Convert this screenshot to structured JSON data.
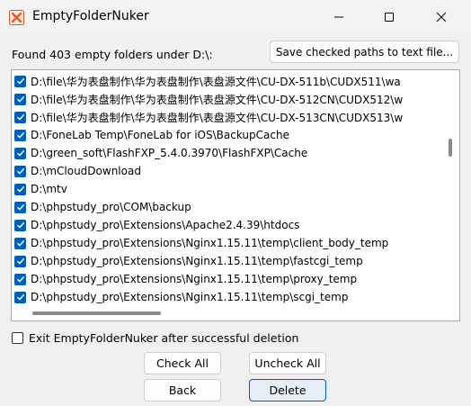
{
  "window": {
    "title": "EmptyFolderNuker",
    "app_icon": "x-icon",
    "controls": [
      "minimize-icon",
      "maximize-icon",
      "close-icon"
    ]
  },
  "header": {
    "found_text": "Found 403 empty folders under D:\\:",
    "save_button": "Save checked paths to text file..."
  },
  "folders": [
    {
      "path": "D:\\file\\华为表盘制作\\华为表盘制作\\表盘源文件\\CU-DX-511b\\CUDX511\\wa",
      "checked": true
    },
    {
      "path": "D:\\file\\华为表盘制作\\华为表盘制作\\表盘源文件\\CU-DX-512CN\\CUDX512\\w",
      "checked": true
    },
    {
      "path": "D:\\file\\华为表盘制作\\华为表盘制作\\表盘源文件\\CU-DX-513CN\\CUDX513\\w",
      "checked": true
    },
    {
      "path": "D:\\FoneLab Temp\\FoneLab for iOS\\BackupCache",
      "checked": true
    },
    {
      "path": "D:\\green_soft\\FlashFXP_5.4.0.3970\\FlashFXP\\Cache",
      "checked": true
    },
    {
      "path": "D:\\mCloudDownload",
      "checked": true
    },
    {
      "path": "D:\\mtv",
      "checked": true
    },
    {
      "path": "D:\\phpstudy_pro\\COM\\backup",
      "checked": true
    },
    {
      "path": "D:\\phpstudy_pro\\Extensions\\Apache2.4.39\\htdocs",
      "checked": true
    },
    {
      "path": "D:\\phpstudy_pro\\Extensions\\Nginx1.15.11\\temp\\client_body_temp",
      "checked": true
    },
    {
      "path": "D:\\phpstudy_pro\\Extensions\\Nginx1.15.11\\temp\\fastcgi_temp",
      "checked": true
    },
    {
      "path": "D:\\phpstudy_pro\\Extensions\\Nginx1.15.11\\temp\\proxy_temp",
      "checked": true
    },
    {
      "path": "D:\\phpstudy_pro\\Extensions\\Nginx1.15.11\\temp\\scgi_temp",
      "checked": true
    }
  ],
  "options": {
    "exit_label": "Exit EmptyFolderNuker after successful deletion",
    "exit_checked": false
  },
  "buttons": {
    "check_all": "Check All",
    "uncheck_all": "Uncheck All",
    "back": "Back",
    "delete": "Delete"
  },
  "colors": {
    "accent": "#005fb8",
    "app_icon": "#e05a2b"
  }
}
